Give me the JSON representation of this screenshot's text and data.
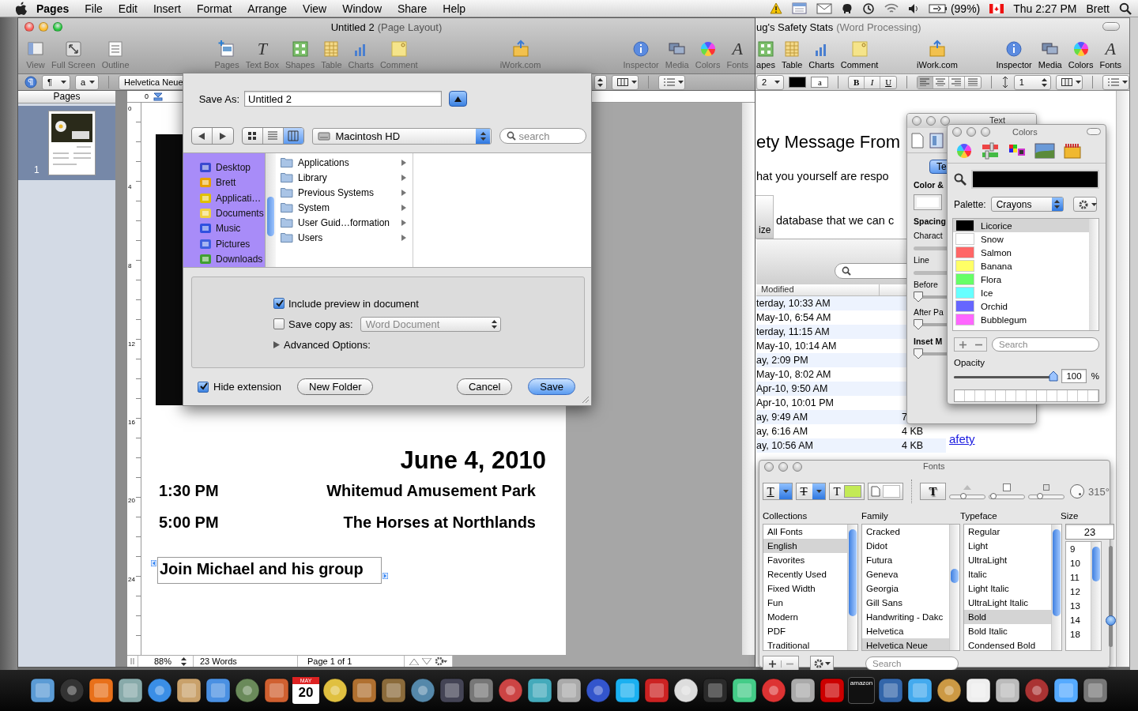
{
  "menu_bar": {
    "app_name": "Pages",
    "menus": [
      "File",
      "Edit",
      "Insert",
      "Format",
      "Arrange",
      "View",
      "Window",
      "Share",
      "Help"
    ],
    "battery": "(99%)",
    "clock": "Thu 2:27 PM",
    "user": "Brett"
  },
  "pages_window": {
    "title": "Untitled 2",
    "subtitle": "(Page Layout)",
    "toolbar": [
      {
        "label": "View"
      },
      {
        "label": "Full Screen"
      },
      {
        "label": "Outline"
      },
      {
        "label": "Pages"
      },
      {
        "label": "Text Box",
        "glyph": "T"
      },
      {
        "label": "Shapes"
      },
      {
        "label": "Table"
      },
      {
        "label": "Charts"
      },
      {
        "label": "Comment"
      },
      {
        "label": "iWork.com"
      },
      {
        "label": "Inspector"
      },
      {
        "label": "Media"
      },
      {
        "label": "Colors"
      },
      {
        "label": "Fonts",
        "glyph": "A"
      }
    ],
    "format_bar": {
      "paragraph_style": "¶",
      "character_style": "a",
      "font": "Helvetica Neue"
    },
    "pages_panel": {
      "title": "Pages",
      "thumbnails": [
        {
          "number": "1",
          "selected": true
        }
      ]
    },
    "ruler": {
      "top_label": "0",
      "side_labels": [
        "0",
        "4",
        "8",
        "12",
        "16",
        "20",
        "24"
      ]
    },
    "document": {
      "date": "June 4, 2010",
      "events": [
        {
          "time": "1:30 PM",
          "place": "Whitemud Amusement Park"
        },
        {
          "time": "5:00 PM",
          "place": "The Horses at Northlands"
        }
      ],
      "note": "Join Michael and his group"
    },
    "status_bar": {
      "zoom": "88%",
      "words": "23 Words",
      "page": "Page 1 of 1"
    }
  },
  "save_dialog": {
    "save_as_label": "Save As:",
    "filename": "Untitled 2",
    "location": "Macintosh HD",
    "search_placeholder": "search",
    "view_modes": [
      {
        "selected": false
      },
      {
        "selected": false
      },
      {
        "selected": true
      }
    ],
    "places": [
      {
        "label": "Desktop"
      },
      {
        "label": "Brett"
      },
      {
        "label": "Applicati…"
      },
      {
        "label": "Documents"
      },
      {
        "label": "Music"
      },
      {
        "label": "Pictures"
      },
      {
        "label": "Downloads"
      }
    ],
    "items": [
      {
        "label": "Applications"
      },
      {
        "label": "Library"
      },
      {
        "label": "Previous Systems"
      },
      {
        "label": "System"
      },
      {
        "label": "User Guid…formation"
      },
      {
        "label": "Users"
      }
    ],
    "include_preview": {
      "label": "Include preview in document",
      "checked": true
    },
    "save_copy": {
      "label": "Save copy as:",
      "checked": false,
      "format": "Word Document"
    },
    "advanced": "Advanced Options:",
    "hide_extension": {
      "label": "Hide extension",
      "checked": true
    },
    "buttons": [
      {
        "label": "New Folder",
        "default": false
      },
      {
        "label": "Cancel",
        "default": false
      },
      {
        "label": "Save",
        "default": true
      }
    ]
  },
  "word_window": {
    "title": "ug's Safety Stats",
    "subtitle": "(Word Processing)",
    "toolbar": [
      {
        "label": "apes"
      },
      {
        "label": "Table"
      },
      {
        "label": "Charts"
      },
      {
        "label": "Comment"
      },
      {
        "label": "iWork.com"
      },
      {
        "label": "Inspector"
      },
      {
        "label": "Media"
      },
      {
        "label": "Colors"
      },
      {
        "label": "Fonts",
        "glyph": "A"
      }
    ],
    "format_bar": {
      "size": "2",
      "character_color": "a",
      "bold": "B",
      "italic": "I",
      "underline": "U",
      "spacing": "1"
    },
    "heading": "ety Message From",
    "lines": [
      "hat you yourself are respo",
      "database that we can c"
    ],
    "size_label": "ize",
    "file_list": {
      "column": "Modified",
      "rows": [
        {
          "modified": "terday, 10:33 AM"
        },
        {
          "modified": "May-10, 6:54 AM"
        },
        {
          "modified": "terday, 11:15 AM"
        },
        {
          "modified": "May-10, 10:14 AM"
        },
        {
          "modified": "ay, 2:09 PM"
        },
        {
          "modified": "May-10, 8:02 AM"
        },
        {
          "modified": "Apr-10, 9:50 AM"
        },
        {
          "modified": "Apr-10, 10:01 PM"
        },
        {
          "modified": "ay, 9:49 AM",
          "size": "7"
        },
        {
          "modified": "ay, 6:16 AM",
          "size": "4 KB"
        },
        {
          "modified": "ay, 10:56 AM",
          "size": "4 KB"
        }
      ]
    },
    "link": "afety"
  },
  "text_inspector": {
    "title": "Text",
    "tab": "Te",
    "sections": [
      {
        "label": "Color &",
        "kind": "swatch"
      },
      {
        "label": "Spacing",
        "kind": "heading"
      },
      {
        "label": "Charact",
        "kind": "slider"
      },
      {
        "label": "Line",
        "kind": "slider"
      },
      {
        "label": "Before",
        "kind": "knob",
        "level": 0
      },
      {
        "label": "After Pa",
        "kind": "knob",
        "level": 0
      },
      {
        "label": "Inset M",
        "kind": "section",
        "level": 0
      }
    ]
  },
  "colors_panel": {
    "title": "Colors",
    "palette_label": "Palette:",
    "palette": "Crayons",
    "colors": [
      {
        "name": "Licorice",
        "color": "#000000",
        "selected": true
      },
      {
        "name": "Snow",
        "color": "#ffffff",
        "selected": false
      },
      {
        "name": "Salmon",
        "color": "#ff6666",
        "selected": false
      },
      {
        "name": "Banana",
        "color": "#ffff66",
        "selected": false
      },
      {
        "name": "Flora",
        "color": "#66ff66",
        "selected": false
      },
      {
        "name": "Ice",
        "color": "#66ffff",
        "selected": false
      },
      {
        "name": "Orchid",
        "color": "#6666ff",
        "selected": false
      },
      {
        "name": "Bubblegum",
        "color": "#ff66ff",
        "selected": false
      }
    ],
    "search_placeholder": "Search",
    "opacity_label": "Opacity",
    "opacity": {
      "level": 0.97
    },
    "opacity_value": "100",
    "percent": "%"
  },
  "fonts_panel": {
    "title": "Fonts",
    "underline_glyph": "T",
    "strike_glyph": "T",
    "color_glyph": "T",
    "shadow_glyph": "T",
    "angle": "315°",
    "headers": [
      "Collections",
      "Family",
      "Typeface",
      "Size"
    ],
    "collections": [
      {
        "label": "All Fonts",
        "selected": false
      },
      {
        "label": "English",
        "selected": true
      },
      {
        "label": "Favorites",
        "selected": false
      },
      {
        "label": "Recently Used",
        "selected": false
      },
      {
        "label": "Fixed Width",
        "selected": false
      },
      {
        "label": "Fun",
        "selected": false
      },
      {
        "label": "Modern",
        "selected": false
      },
      {
        "label": "PDF",
        "selected": false
      },
      {
        "label": "Traditional",
        "selected": false
      }
    ],
    "families": [
      {
        "label": "Cracked",
        "selected": false
      },
      {
        "label": "Didot",
        "selected": false
      },
      {
        "label": "Futura",
        "selected": false
      },
      {
        "label": "Geneva",
        "selected": false
      },
      {
        "label": "Georgia",
        "selected": false
      },
      {
        "label": "Gill Sans",
        "selected": false
      },
      {
        "label": "Handwriting - Dakc",
        "selected": false
      },
      {
        "label": "Helvetica",
        "selected": false
      },
      {
        "label": "Helvetica Neue",
        "selected": true
      }
    ],
    "typefaces": [
      {
        "label": "Regular",
        "selected": false
      },
      {
        "label": "Light",
        "selected": false
      },
      {
        "label": "UltraLight",
        "selected": false
      },
      {
        "label": "Italic",
        "selected": false
      },
      {
        "label": "Light Italic",
        "selected": false
      },
      {
        "label": "UltraLight Italic",
        "selected": false
      },
      {
        "label": "Bold",
        "selected": true
      },
      {
        "label": "Bold Italic",
        "selected": false
      },
      {
        "label": "Condensed Bold",
        "selected": false
      }
    ],
    "shadow_sliders": [
      {
        "level": 0.39
      },
      {
        "level": 0.11
      },
      {
        "level": 0.31
      }
    ],
    "size_slider": {
      "level": 0.26
    },
    "size": "23",
    "sizes": [
      "9",
      "10",
      "11",
      "12",
      "13",
      "14",
      "18"
    ],
    "search_placeholder": "Search"
  },
  "dock": {
    "calendar_month": "MAY",
    "calendar_day": "20",
    "store_label": "amazon"
  }
}
